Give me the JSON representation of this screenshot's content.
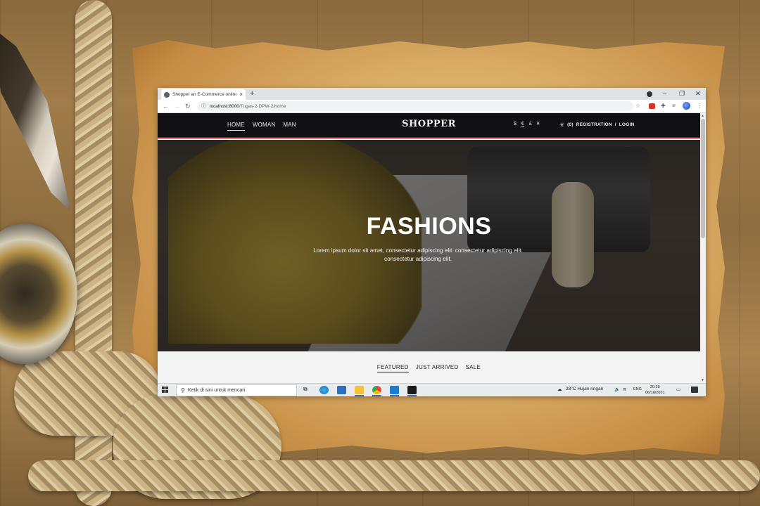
{
  "browser": {
    "tab_title": "Shopper an E-Commerce online",
    "new_tab_glyph": "+",
    "tab_close_glyph": "×",
    "url_host": "localhost:8000",
    "url_path": "/Tugas-2-DPW-2/home",
    "window_controls": {
      "minimize": "–",
      "restore": "❐",
      "close": "✕"
    }
  },
  "site": {
    "brand": "SHOPPER",
    "nav": [
      {
        "label": "HOME",
        "active": true
      },
      {
        "label": "WOMAN",
        "active": false
      },
      {
        "label": "MAN",
        "active": false
      }
    ],
    "currencies": [
      "$",
      "€",
      "£",
      "¥"
    ],
    "active_currency": "€",
    "basket_count": "(0)",
    "registration": "REGISTRATION",
    "separator": "/",
    "login": "LOGIN",
    "accent_color": "#a31c1c"
  },
  "hero": {
    "title": "FASHIONS",
    "text": "Lorem ipsum dolor sit amet, consectetur adipiscing elit. consectetur adipiscing elit. consectetur adipiscing elit."
  },
  "filter_tabs": [
    {
      "label": "FEATURED",
      "active": true
    },
    {
      "label": "JUST ARRIVED",
      "active": false
    },
    {
      "label": "SALE",
      "active": false
    }
  ],
  "taskbar": {
    "search_placeholder": "Ketik di sini untuk mencari",
    "weather": "28°C  Hujan ringan",
    "language": "ENG",
    "time": "20:39",
    "date": "06/10/2021"
  },
  "icons": {
    "start": "windows-start-icon",
    "search": "search-icon",
    "basket": "basket-icon",
    "lock": "info-icon"
  }
}
